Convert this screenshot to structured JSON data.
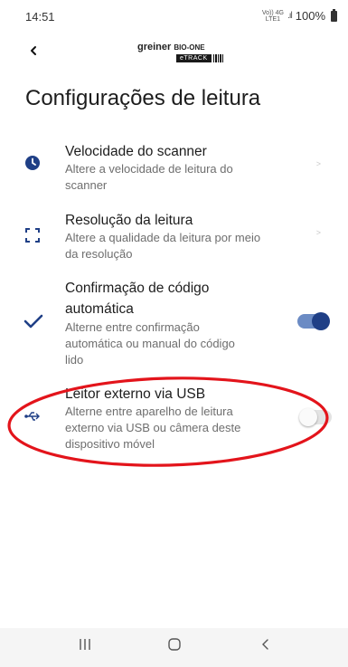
{
  "status_bar": {
    "time": "14:51",
    "network_top": "Vo)) 4G",
    "network_bottom": "LTE1",
    "battery": "100%"
  },
  "header": {
    "logo_main": "greiner",
    "logo_bio": "BIO-ONE",
    "logo_product": "eTRACK"
  },
  "page": {
    "title": "Configurações de leitura"
  },
  "settings": [
    {
      "title": "Velocidade do scanner",
      "description_lines": [
        "Altere a velocidade de leitura do",
        "scanner"
      ],
      "icon": "clock-icon",
      "control": "chevron"
    },
    {
      "title": "Resolução da leitura",
      "description_lines": [
        "Altere a qualidade da leitura por meio",
        "da resolução"
      ],
      "icon": "scan-frame-icon",
      "control": "chevron"
    },
    {
      "title_lines": [
        "Confirmação de código",
        "automática"
      ],
      "description_lines": [
        "Alterne entre confirmação",
        "automática ou manual do código",
        "lido"
      ],
      "icon": "checkmark-icon",
      "control": "toggle",
      "enabled": true
    },
    {
      "title": "Leitor externo via USB",
      "description_lines": [
        "Alterne entre aparelho de leitura",
        "externo via USB ou câmera deste",
        "dispositivo móvel"
      ],
      "icon": "usb-icon",
      "control": "toggle",
      "enabled": false
    }
  ],
  "colors": {
    "accent": "#1f3f86",
    "toggle_track_on": "#6b8bc4",
    "annotation": "#e3141b"
  },
  "nav": {
    "recents": "recents-icon",
    "home": "home-icon",
    "back": "back-icon"
  }
}
